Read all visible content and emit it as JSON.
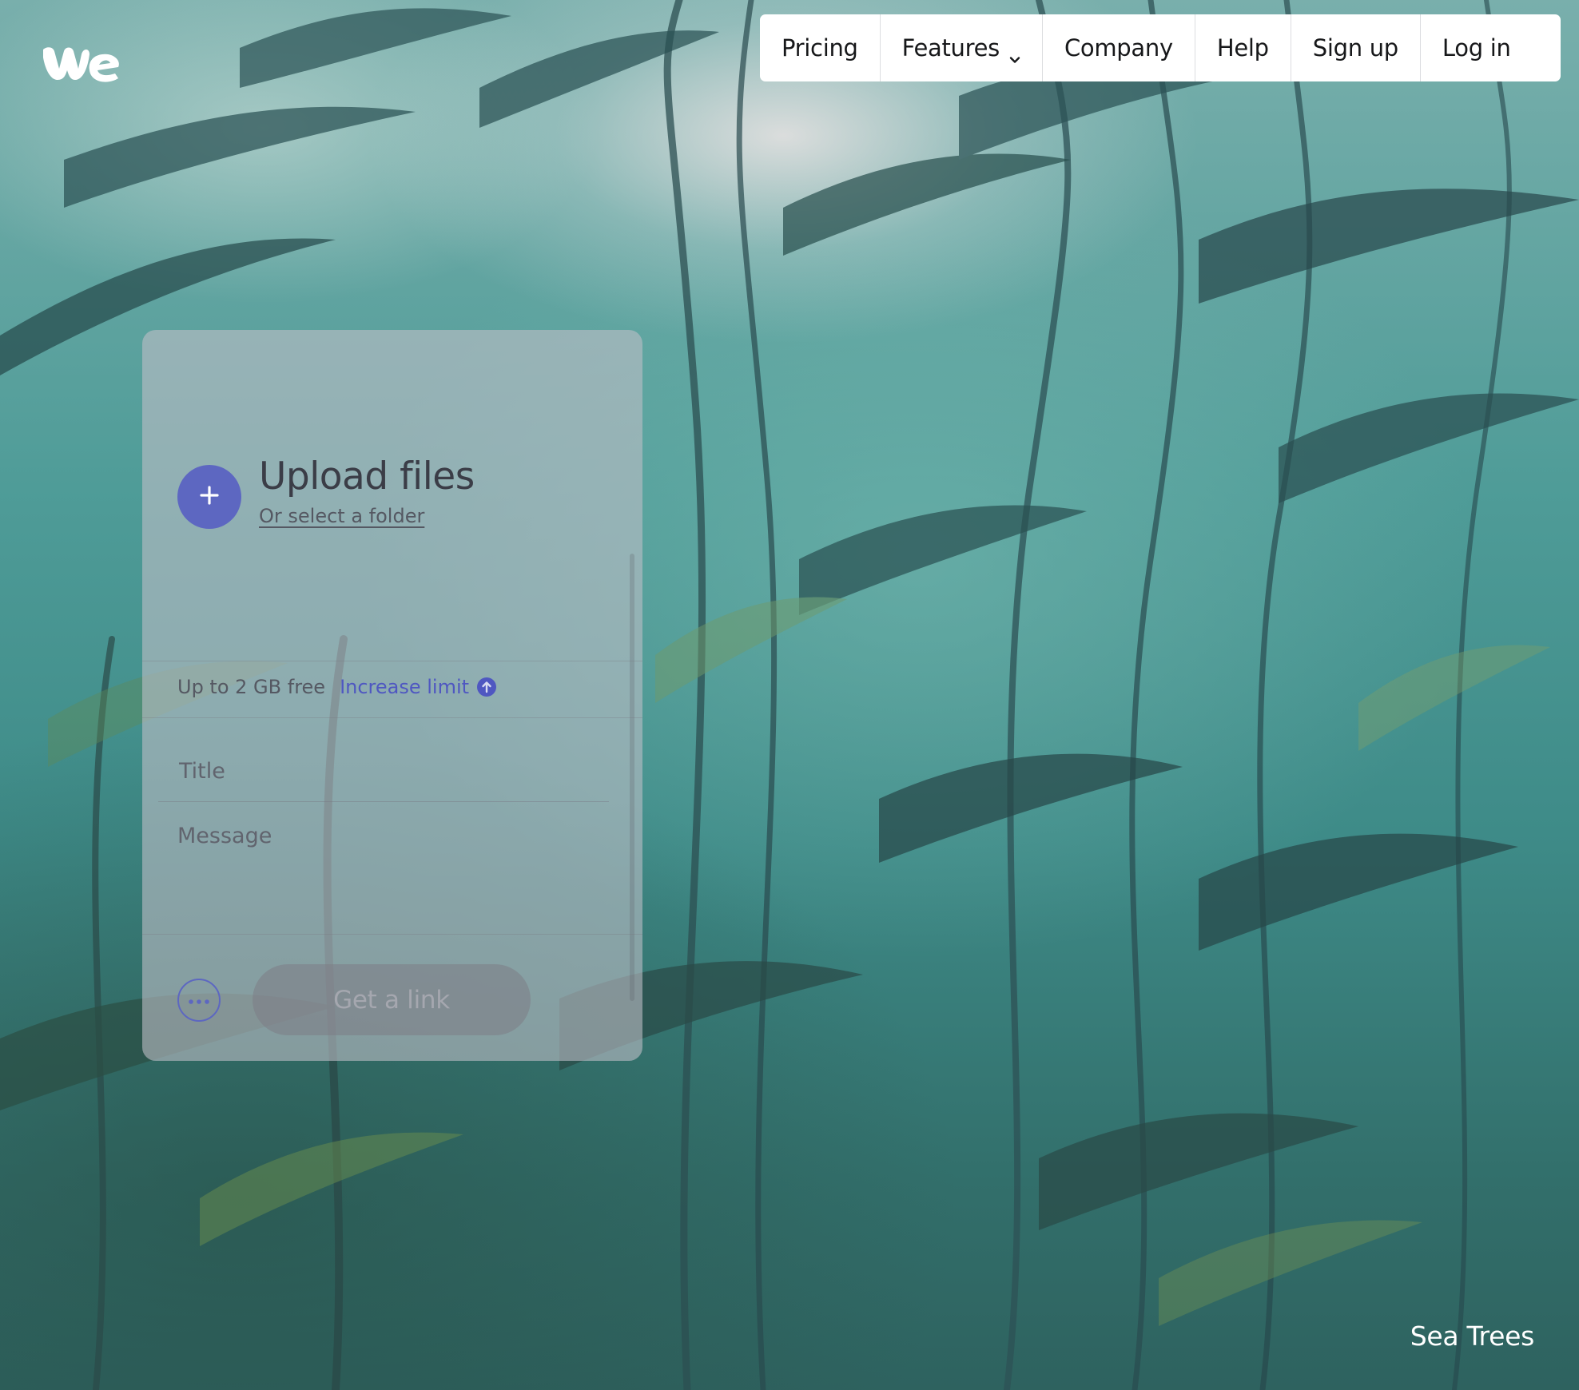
{
  "logo": {
    "icon": "wetransfer-logo-icon",
    "color": "#ffffff"
  },
  "nav": {
    "items": [
      {
        "label": "Pricing"
      },
      {
        "label": "Features",
        "icon": "chevron-down-icon"
      },
      {
        "label": "Company"
      },
      {
        "label": "Help"
      },
      {
        "label": "Sign up"
      },
      {
        "label": "Log in"
      }
    ]
  },
  "upload_panel": {
    "add_icon": "plus-icon",
    "title": "Upload files",
    "folder_link": "Or select a folder",
    "limit_text": "Up to 2 GB free",
    "increase_link": "Increase limit",
    "increase_icon": "arrow-up-circle-icon",
    "title_placeholder": "Title",
    "message_placeholder": "Message",
    "options_icon": "more-options-icon",
    "get_link_label": "Get a link",
    "accent_color": "#5d67c1"
  },
  "background": {
    "caption": "Sea Trees"
  }
}
